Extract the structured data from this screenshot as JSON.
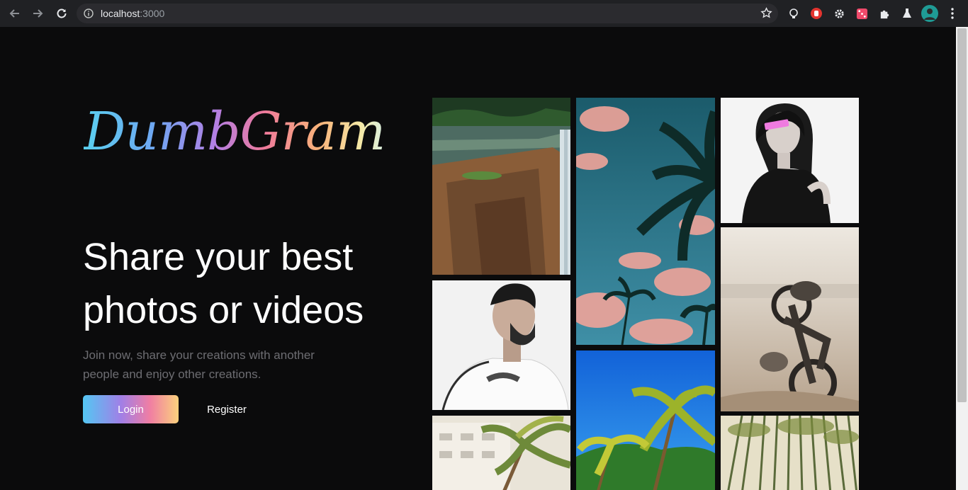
{
  "browser": {
    "url_host": "localhost",
    "url_port": ":3000"
  },
  "brand": {
    "logo_text": "DumbGram"
  },
  "hero": {
    "headline": "Share your best photos or videos",
    "subtitle": "Join now, share your creations with another people and enjoy other creations."
  },
  "actions": {
    "login_label": "Login",
    "register_label": "Register"
  },
  "colors": {
    "page_bg": "#0b0b0c",
    "gradient": [
      "#54c7f3",
      "#a17fe6",
      "#f07ea3",
      "#fbd17d"
    ]
  },
  "gallery": {
    "photos": [
      "waterfall-cliff-photo",
      "bearded-man-portrait-photo",
      "palm-tree-building-photo",
      "palm-trees-pink-clouds-photo",
      "palm-trees-blue-sky-photo",
      "woman-portrait-photo",
      "motorcycle-sand-photo",
      "bamboo-forest-photo"
    ]
  }
}
